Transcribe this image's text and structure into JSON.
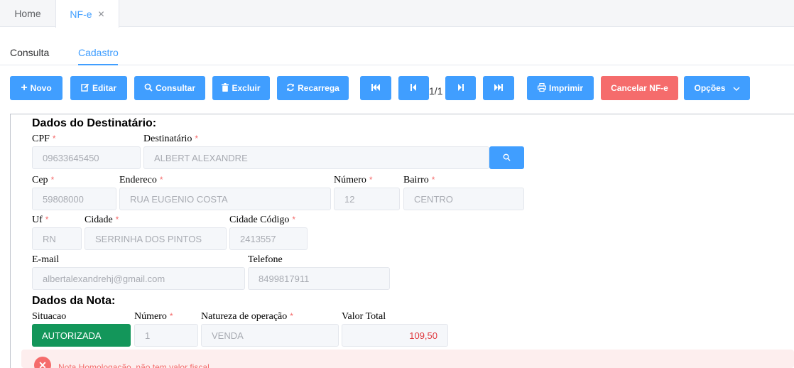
{
  "tabs": {
    "home": "Home",
    "nfe": "NF-e",
    "close_glyph": "✕"
  },
  "subtabs": {
    "consulta": "Consulta",
    "cadastro": "Cadastro"
  },
  "toolbar": {
    "novo": "Novo",
    "editar": "Editar",
    "consultar": "Consultar",
    "excluir": "Excluir",
    "recarrega": "Recarrega",
    "pager": "1/1",
    "imprimir": "Imprimir",
    "cancelar": "Cancelar NF-e",
    "opcoes": "Opções"
  },
  "destinatario": {
    "title": "Dados do Destinatário:",
    "cpf_label": "CPF",
    "cpf": "09633645450",
    "dest_label": "Destinatário",
    "dest": "ALBERT ALEXANDRE",
    "cep_label": "Cep",
    "cep": "59808000",
    "endereco_label": "Endereco",
    "endereco": "RUA EUGENIO COSTA",
    "numero_label": "Número",
    "numero": "12",
    "bairro_label": "Bairro",
    "bairro": "CENTRO",
    "uf_label": "Uf",
    "uf": "RN",
    "cidade_label": "Cidade",
    "cidade": "SERRINHA DOS PINTOS",
    "cidade_cod_label": "Cidade Código",
    "cidade_cod": "2413557",
    "email_label": "E-mail",
    "email": "albertalexandrehj@gmail.com",
    "telefone_label": "Telefone",
    "telefone": "8499817911"
  },
  "nota": {
    "title": "Dados da Nota:",
    "situacao_label": "Situacao",
    "situacao": "AUTORIZADA",
    "numero_label": "Número",
    "numero": "1",
    "natureza_label": "Natureza de operação",
    "natureza": "VENDA",
    "valor_label": "Valor Total",
    "valor": "109,50"
  },
  "alert": {
    "text": "Nota Homologação, não tem valor fiscal"
  },
  "required_mark": "*",
  "colors": {
    "primary": "#409eff",
    "danger": "#f56c6c",
    "success": "#13965a"
  }
}
